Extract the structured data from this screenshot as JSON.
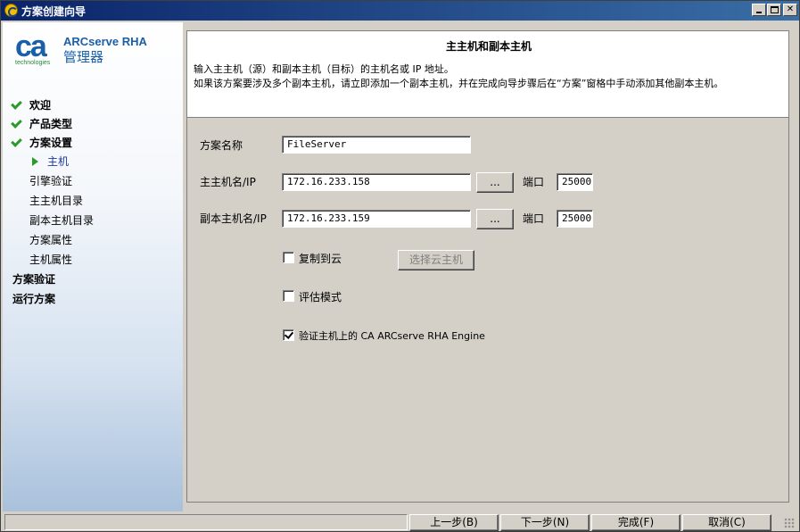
{
  "window": {
    "title": "方案创建向导",
    "controls": {
      "minimize": "_",
      "maximize": "□",
      "close": "✕"
    }
  },
  "sidebar": {
    "logo": {
      "mark": "ca",
      "tagline": "technologies"
    },
    "brand_line1": "ARCserve RHA",
    "brand_line2": "管理器",
    "items": [
      {
        "label": "欢迎",
        "state": "done"
      },
      {
        "label": "产品类型",
        "state": "done"
      },
      {
        "label": "方案设置",
        "state": "done"
      },
      {
        "label": "主机",
        "state": "current"
      },
      {
        "label": "引擎验证",
        "state": "pending"
      },
      {
        "label": "主主机目录",
        "state": "pending"
      },
      {
        "label": "副本主机目录",
        "state": "pending"
      },
      {
        "label": "方案属性",
        "state": "pending"
      },
      {
        "label": "主机属性",
        "state": "pending"
      },
      {
        "label": "方案验证",
        "state": "section"
      },
      {
        "label": "运行方案",
        "state": "section"
      }
    ]
  },
  "header": {
    "title": "主主机和副本主机",
    "line1": "输入主主机（源）和副本主机（目标）的主机名或 IP 地址。",
    "line2": "如果该方案要涉及多个副本主机，请立即添加一个副本主机，并在完成向导步骤后在“方案”窗格中手动添加其他副本主机。"
  },
  "form": {
    "scenario_name_label": "方案名称",
    "scenario_name_value": "FileServer",
    "master_label": "主主机名/IP",
    "master_value": "172.16.233.158",
    "master_port_label": "端口",
    "master_port_value": "25000",
    "replica_label": "副本主机名/IP",
    "replica_value": "172.16.233.159",
    "replica_port_label": "端口",
    "replica_port_value": "25000",
    "browse_label": "...",
    "cloud_label": "复制到云",
    "cloud_checked": false,
    "select_cloud_host_label": "选择云主机",
    "eval_label": "评估模式",
    "eval_checked": false,
    "verify_label": "验证主机上的 CA ARCserve RHA Engine",
    "verify_checked": true
  },
  "footer": {
    "back": "上一步(B)",
    "next": "下一步(N)",
    "finish": "完成(F)",
    "cancel": "取消(C)"
  }
}
